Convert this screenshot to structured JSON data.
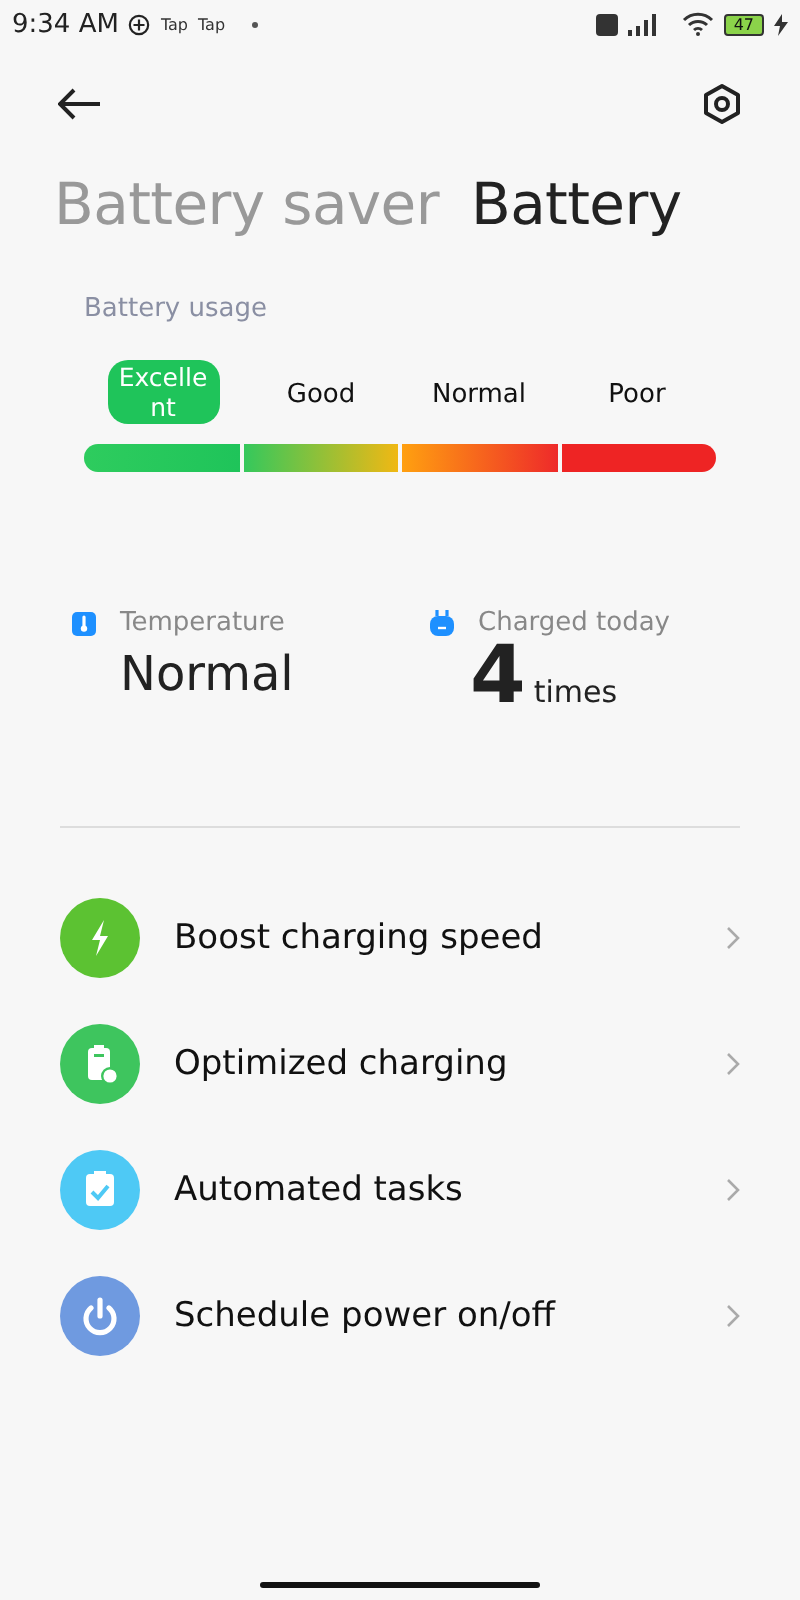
{
  "status_bar": {
    "time": "9:34 AM",
    "notifications": [
      "Tap",
      "Tap"
    ],
    "battery": "47"
  },
  "tabs": [
    {
      "label": "Battery saver",
      "selected": false
    },
    {
      "label": "Battery",
      "selected": true
    }
  ],
  "usage": {
    "title": "Battery usage",
    "levels": [
      {
        "label": "Excellent",
        "selected": true
      },
      {
        "label": "Good",
        "selected": false
      },
      {
        "label": "Normal",
        "selected": false
      },
      {
        "label": "Poor",
        "selected": false
      }
    ]
  },
  "stats": [
    {
      "kind": "temperature",
      "label": "Temperature",
      "value": "Normal"
    },
    {
      "kind": "charged",
      "label": "Charged today",
      "value": "4",
      "unit": "times"
    }
  ],
  "items": [
    {
      "kind": "bolt",
      "label": "Boost charging speed",
      "color": "#5cc232"
    },
    {
      "kind": "clipboard",
      "label": "Optimized charging",
      "color": "#3ec55e"
    },
    {
      "kind": "check",
      "label": "Automated tasks",
      "color": "#4ec9f5"
    },
    {
      "kind": "power",
      "label": "Schedule power on/off",
      "color": "#6f9ae0"
    }
  ]
}
